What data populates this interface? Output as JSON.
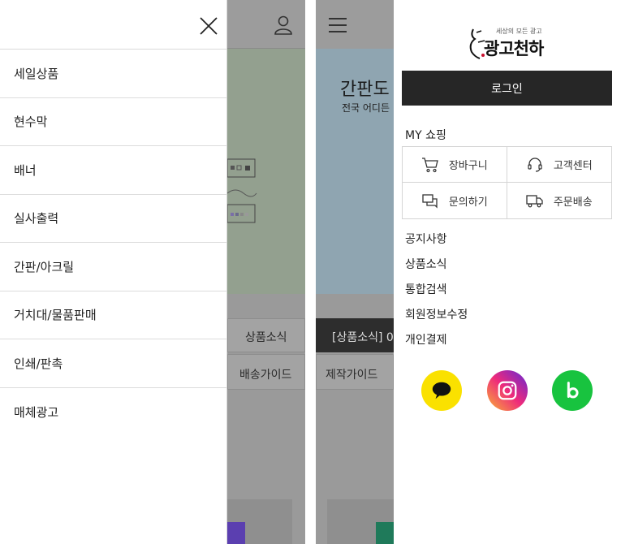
{
  "left_drawer": {
    "close_icon": "close-icon",
    "menu": [
      {
        "label": "세일상품"
      },
      {
        "label": "현수막"
      },
      {
        "label": "배너"
      },
      {
        "label": "실사출력"
      },
      {
        "label": "간판/아크릴"
      },
      {
        "label": "거치대/물품판매"
      },
      {
        "label": "인쇄/판촉"
      },
      {
        "label": "매체광고"
      }
    ]
  },
  "left_background": {
    "user_icon": "user-icon",
    "tab_news": "상품소식",
    "tab_shipping": "배송가이드"
  },
  "right_background": {
    "menu_icon": "hamburger-menu-icon",
    "hero_title": "간판도 ",
    "hero_sub": "전국 어디든",
    "notice_bar": "[상품소식] 0",
    "tab_production": "제작가이드"
  },
  "right_drawer": {
    "logo": {
      "small_text": "세상의 모든 광고",
      "main_text": "광고천하"
    },
    "login_label": "로그인",
    "my_shopping_title": "MY 쇼핑",
    "shortcuts": [
      {
        "label": "장바구니",
        "icon": "cart-icon"
      },
      {
        "label": "고객센터",
        "icon": "headset-icon"
      },
      {
        "label": "문의하기",
        "icon": "chat-icon"
      },
      {
        "label": "주문배송",
        "icon": "truck-icon"
      }
    ],
    "links": [
      {
        "label": "공지사항"
      },
      {
        "label": "상품소식"
      },
      {
        "label": "통합검색"
      },
      {
        "label": "회원정보수정"
      },
      {
        "label": "개인결제"
      }
    ],
    "social": [
      {
        "name": "kakaotalk",
        "icon": "kakaotalk-icon",
        "color": "#fae100"
      },
      {
        "name": "instagram",
        "icon": "instagram-icon",
        "color": "#ee2a7b"
      },
      {
        "name": "band",
        "icon": "band-icon",
        "color": "#18c33f"
      }
    ]
  }
}
